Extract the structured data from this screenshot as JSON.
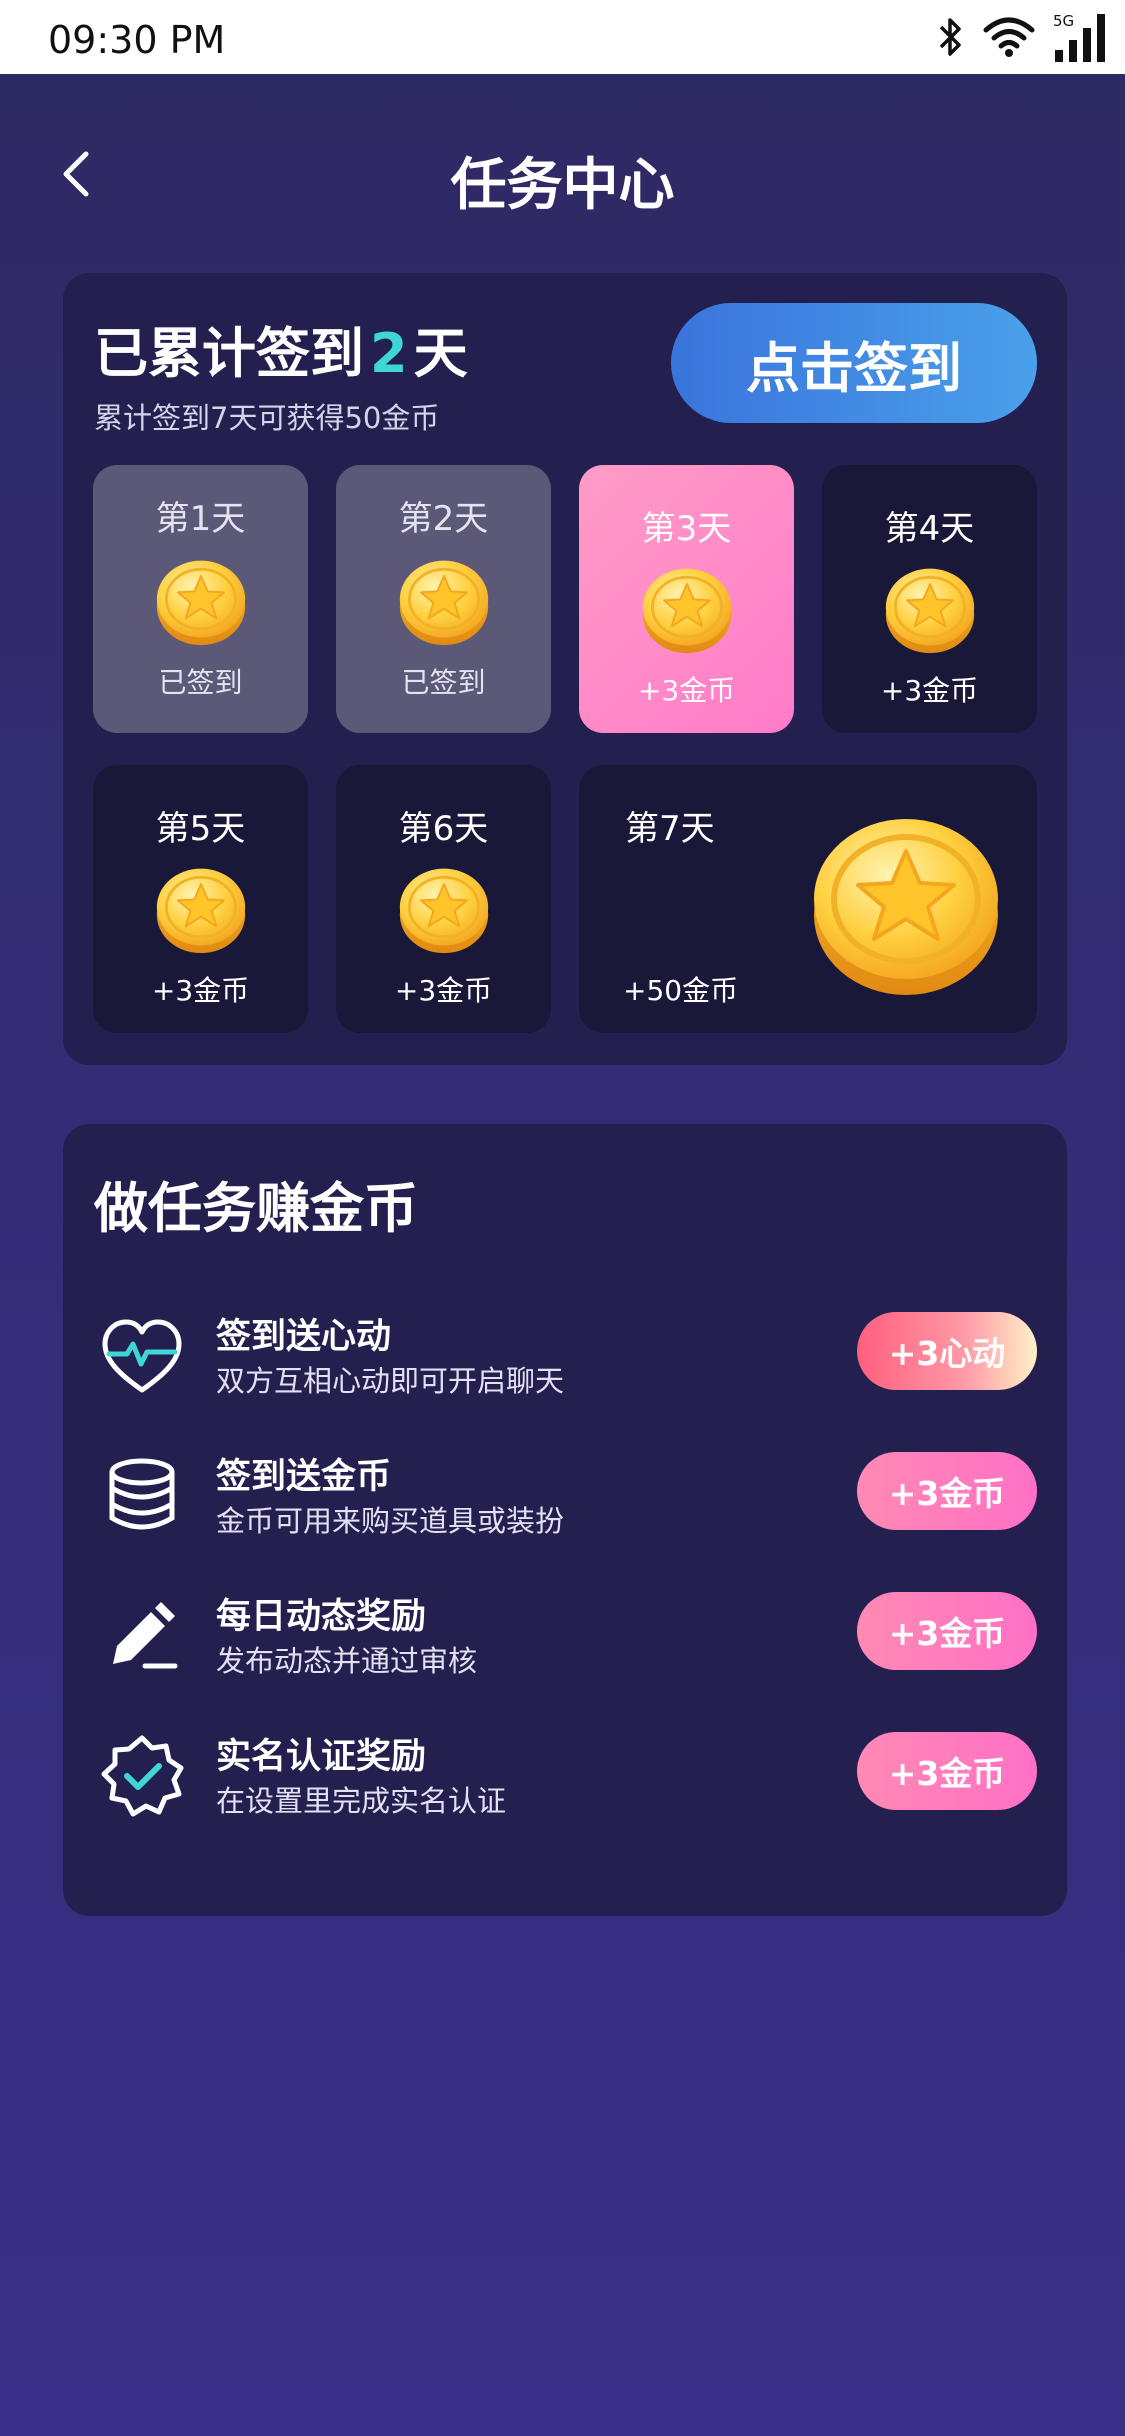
{
  "status_bar": {
    "time": "09:30 PM",
    "network": "5G"
  },
  "header": {
    "title": "任务中心"
  },
  "checkin": {
    "title_prefix": "已累计签到",
    "count": "2",
    "title_suffix": "天",
    "subtitle": "累计签到7天可获得50金币",
    "button_label": "点击签到",
    "days": [
      {
        "label": "第1天",
        "reward": "已签到",
        "state": "done"
      },
      {
        "label": "第2天",
        "reward": "已签到",
        "state": "done"
      },
      {
        "label": "第3天",
        "reward": "+3金币",
        "state": "today"
      },
      {
        "label": "第4天",
        "reward": "+3金币",
        "state": "pending"
      },
      {
        "label": "第5天",
        "reward": "+3金币",
        "state": "pending"
      },
      {
        "label": "第6天",
        "reward": "+3金币",
        "state": "pending"
      },
      {
        "label": "第7天",
        "reward": "+50金币",
        "state": "pending"
      }
    ]
  },
  "tasks": {
    "title": "做任务赚金币",
    "items": [
      {
        "name": "签到送心动",
        "desc": "双方互相心动即可开启聊天",
        "reward": "+3心动",
        "icon": "heart-pulse-icon"
      },
      {
        "name": "签到送金币",
        "desc": "金币可用来购买道具或装扮",
        "reward": "+3金币",
        "icon": "coin-stack-icon"
      },
      {
        "name": "每日动态奖励",
        "desc": "发布动态并通过审核",
        "reward": "+3金币",
        "icon": "pencil-icon"
      },
      {
        "name": "实名认证奖励",
        "desc": "在设置里完成实名认证",
        "reward": "+3金币",
        "icon": "verified-badge-icon"
      }
    ]
  },
  "colors": {
    "accent": "#3fd6d6",
    "button_blue": "#3a74dc",
    "pink": "#ff7bc9"
  }
}
